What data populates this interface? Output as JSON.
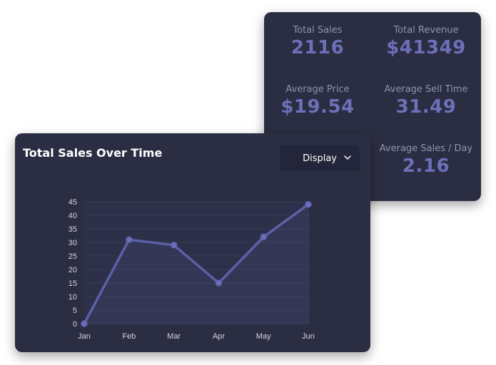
{
  "stats": {
    "total_sales": {
      "label": "Total Sales",
      "value": "2116"
    },
    "total_revenue": {
      "label": "Total Revenue",
      "value": "$41349"
    },
    "average_price": {
      "label": "Average Price",
      "value": "$19.54"
    },
    "average_sell_time": {
      "label": "Average Sell Time",
      "value": "31.49"
    },
    "average_sales_day": {
      "label": "Average Sales / Day",
      "value": "2.16"
    }
  },
  "chart_panel": {
    "title": "Total Sales Over Time",
    "display_button": "Display"
  },
  "colors": {
    "card_bg": "#2b2d42",
    "accent": "#6c70b8",
    "line": "#5c60a8"
  },
  "chart_data": {
    "type": "line",
    "categories": [
      "Jan",
      "Feb",
      "Mar",
      "Apr",
      "May",
      "Jun"
    ],
    "series": [
      {
        "values": [
          0,
          31,
          29,
          15,
          32,
          44
        ]
      }
    ],
    "title": "Total Sales Over Time",
    "xlabel": "",
    "ylabel": "",
    "ylim": [
      0,
      45
    ],
    "yticks": [
      "0",
      "5",
      "10",
      "15",
      "20",
      "25",
      "30",
      "35",
      "40",
      "45"
    ],
    "grid": true,
    "fill_under": true
  }
}
